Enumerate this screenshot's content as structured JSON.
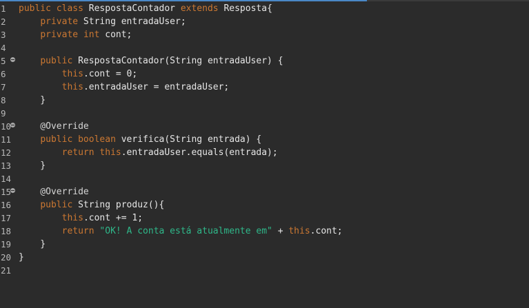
{
  "colors": {
    "background": "#2b2b2b",
    "keyword": "#cc7832",
    "string": "#2fb88a",
    "text": "#e6e6e6",
    "line_number": "#b9b9b9",
    "accent_bar": "#4a88c7"
  },
  "gutter": {
    "lines": [
      {
        "num": "1",
        "fold": false
      },
      {
        "num": "2",
        "fold": false
      },
      {
        "num": "3",
        "fold": false
      },
      {
        "num": "4",
        "fold": false
      },
      {
        "num": "5",
        "fold": true
      },
      {
        "num": "6",
        "fold": false
      },
      {
        "num": "7",
        "fold": false
      },
      {
        "num": "8",
        "fold": false
      },
      {
        "num": "9",
        "fold": false
      },
      {
        "num": "10",
        "fold": true
      },
      {
        "num": "11",
        "fold": false
      },
      {
        "num": "12",
        "fold": false
      },
      {
        "num": "13",
        "fold": false
      },
      {
        "num": "14",
        "fold": false
      },
      {
        "num": "15",
        "fold": true
      },
      {
        "num": "16",
        "fold": false
      },
      {
        "num": "17",
        "fold": false
      },
      {
        "num": "18",
        "fold": false
      },
      {
        "num": "19",
        "fold": false
      },
      {
        "num": "20",
        "fold": false
      },
      {
        "num": "21",
        "fold": false
      }
    ]
  },
  "code": {
    "lines": [
      [
        {
          "t": "public",
          "k": "kw"
        },
        {
          "t": " ",
          "k": "plain"
        },
        {
          "t": "class",
          "k": "kw"
        },
        {
          "t": " RespostaContador ",
          "k": "plain"
        },
        {
          "t": "extends",
          "k": "kw"
        },
        {
          "t": " Resposta{",
          "k": "plain"
        }
      ],
      [
        {
          "t": "    ",
          "k": "plain"
        },
        {
          "t": "private",
          "k": "kw"
        },
        {
          "t": " String entradaUser;",
          "k": "plain"
        }
      ],
      [
        {
          "t": "    ",
          "k": "plain"
        },
        {
          "t": "private",
          "k": "kw"
        },
        {
          "t": " ",
          "k": "plain"
        },
        {
          "t": "int",
          "k": "kw"
        },
        {
          "t": " cont;",
          "k": "plain"
        }
      ],
      [],
      [
        {
          "t": "    ",
          "k": "plain"
        },
        {
          "t": "public",
          "k": "kw"
        },
        {
          "t": " RespostaContador(String entradaUser) {",
          "k": "plain"
        }
      ],
      [
        {
          "t": "        ",
          "k": "plain"
        },
        {
          "t": "this",
          "k": "kw"
        },
        {
          "t": ".cont = 0;",
          "k": "plain"
        }
      ],
      [
        {
          "t": "        ",
          "k": "plain"
        },
        {
          "t": "this",
          "k": "kw"
        },
        {
          "t": ".entradaUser = entradaUser;",
          "k": "plain"
        }
      ],
      [
        {
          "t": "    }",
          "k": "plain"
        }
      ],
      [],
      [
        {
          "t": "    @Override",
          "k": "ann"
        }
      ],
      [
        {
          "t": "    ",
          "k": "plain"
        },
        {
          "t": "public",
          "k": "kw"
        },
        {
          "t": " ",
          "k": "plain"
        },
        {
          "t": "boolean",
          "k": "kw"
        },
        {
          "t": " verifica(String entrada) {",
          "k": "plain"
        }
      ],
      [
        {
          "t": "        ",
          "k": "plain"
        },
        {
          "t": "return",
          "k": "kw"
        },
        {
          "t": " ",
          "k": "plain"
        },
        {
          "t": "this",
          "k": "kw"
        },
        {
          "t": ".entradaUser.equals(entrada);",
          "k": "plain"
        }
      ],
      [
        {
          "t": "    }",
          "k": "plain"
        }
      ],
      [],
      [
        {
          "t": "    @Override",
          "k": "ann"
        }
      ],
      [
        {
          "t": "    ",
          "k": "plain"
        },
        {
          "t": "public",
          "k": "kw"
        },
        {
          "t": " String produz(){",
          "k": "plain"
        }
      ],
      [
        {
          "t": "        ",
          "k": "plain"
        },
        {
          "t": "this",
          "k": "kw"
        },
        {
          "t": ".cont += 1;",
          "k": "plain"
        }
      ],
      [
        {
          "t": "        ",
          "k": "plain"
        },
        {
          "t": "return",
          "k": "kw"
        },
        {
          "t": " ",
          "k": "plain"
        },
        {
          "t": "\"OK! A conta está atualmente em\"",
          "k": "str"
        },
        {
          "t": " + ",
          "k": "plain"
        },
        {
          "t": "this",
          "k": "kw"
        },
        {
          "t": ".cont;",
          "k": "plain"
        }
      ],
      [
        {
          "t": "    }",
          "k": "plain"
        }
      ],
      [
        {
          "t": "}",
          "k": "plain"
        }
      ],
      []
    ]
  }
}
